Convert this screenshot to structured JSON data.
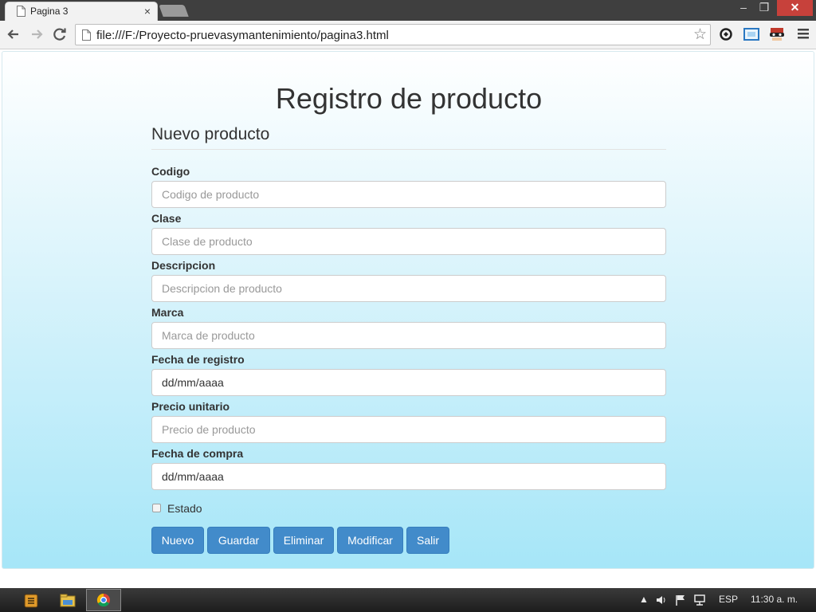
{
  "browser": {
    "tab_title": "Pagina 3",
    "tab_close": "×",
    "url": "file:///F:/Proyecto-pruevasymantenimiento/pagina3.html",
    "window_min": "‒",
    "window_max": "❐",
    "window_close": "✕",
    "icons": [
      "page-icon",
      "back-arrow-icon",
      "forward-arrow-icon",
      "reload-icon",
      "star-icon",
      "sync-extension-icon",
      "screen-capture-extension-icon",
      "incognito-mask-extension-icon",
      "menu-icon"
    ]
  },
  "page": {
    "title": "Registro de producto",
    "legend": "Nuevo producto",
    "fields": [
      {
        "label": "Codigo",
        "placeholder": "Codigo de producto",
        "value": ""
      },
      {
        "label": "Clase",
        "placeholder": "Clase de producto",
        "value": ""
      },
      {
        "label": "Descripcion",
        "placeholder": "Descripcion de producto",
        "value": ""
      },
      {
        "label": "Marca",
        "placeholder": "Marca de producto",
        "value": ""
      },
      {
        "label": "Fecha de registro",
        "placeholder": "",
        "value": "dd/mm/aaaa"
      },
      {
        "label": "Precio unitario",
        "placeholder": "Precio de producto",
        "value": ""
      },
      {
        "label": "Fecha de compra",
        "placeholder": "",
        "value": "dd/mm/aaaa"
      }
    ],
    "checkbox": {
      "label": "Estado",
      "checked": false
    },
    "buttons": [
      "Nuevo",
      "Guardar",
      "Eliminar",
      "Modificar",
      "Salir"
    ],
    "colors": {
      "button": "#428bca",
      "gradient_bottom": "#a6e6f8"
    }
  },
  "taskbar": {
    "apps": [
      "sublime-text-icon",
      "file-explorer-icon",
      "chrome-icon"
    ],
    "language": "ESP",
    "clock": "11:30 a. m."
  }
}
